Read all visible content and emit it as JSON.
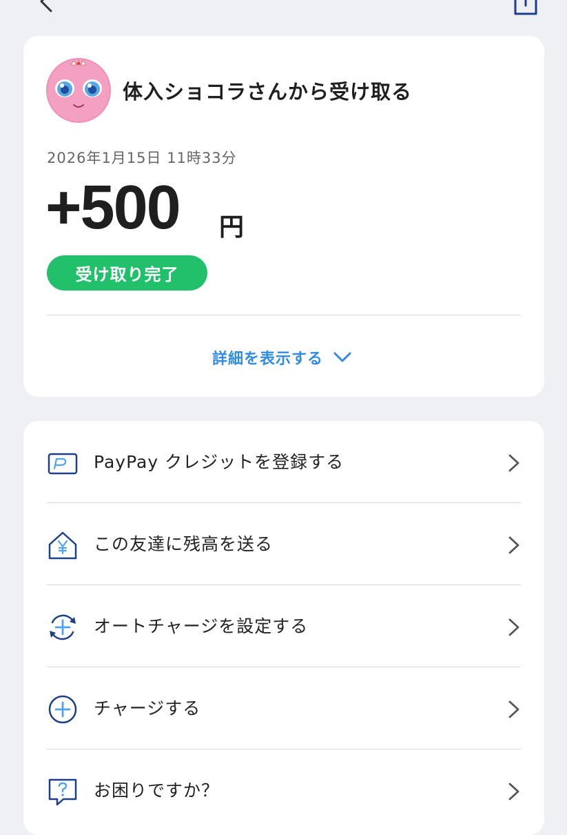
{
  "header": {
    "back_icon": "chevron-left-icon",
    "share_icon": "share-icon"
  },
  "transaction": {
    "avatar_icon": "pink-character-avatar",
    "title": "体入ショコラさんから受け取る",
    "datetime": "2026年1月15日 11時33分",
    "amount": "+500",
    "currency": "円",
    "status": "受け取り完了",
    "details_label": "詳細を表示する"
  },
  "menu": {
    "items": [
      {
        "label": "PayPay クレジットを登録する",
        "icon": "paypay-card-icon"
      },
      {
        "label": "この友達に残高を送る",
        "icon": "send-yen-house-icon"
      },
      {
        "label": "オートチャージを設定する",
        "icon": "auto-charge-icon"
      },
      {
        "label": "チャージする",
        "icon": "plus-circle-icon"
      },
      {
        "label": "お困りですか？",
        "icon": "help-bubble-icon"
      }
    ]
  },
  "colors": {
    "accent_blue": "#2f8ce6",
    "status_green": "#23c06b",
    "icon_navy": "#1c3f8c",
    "background": "#eff0f4"
  }
}
